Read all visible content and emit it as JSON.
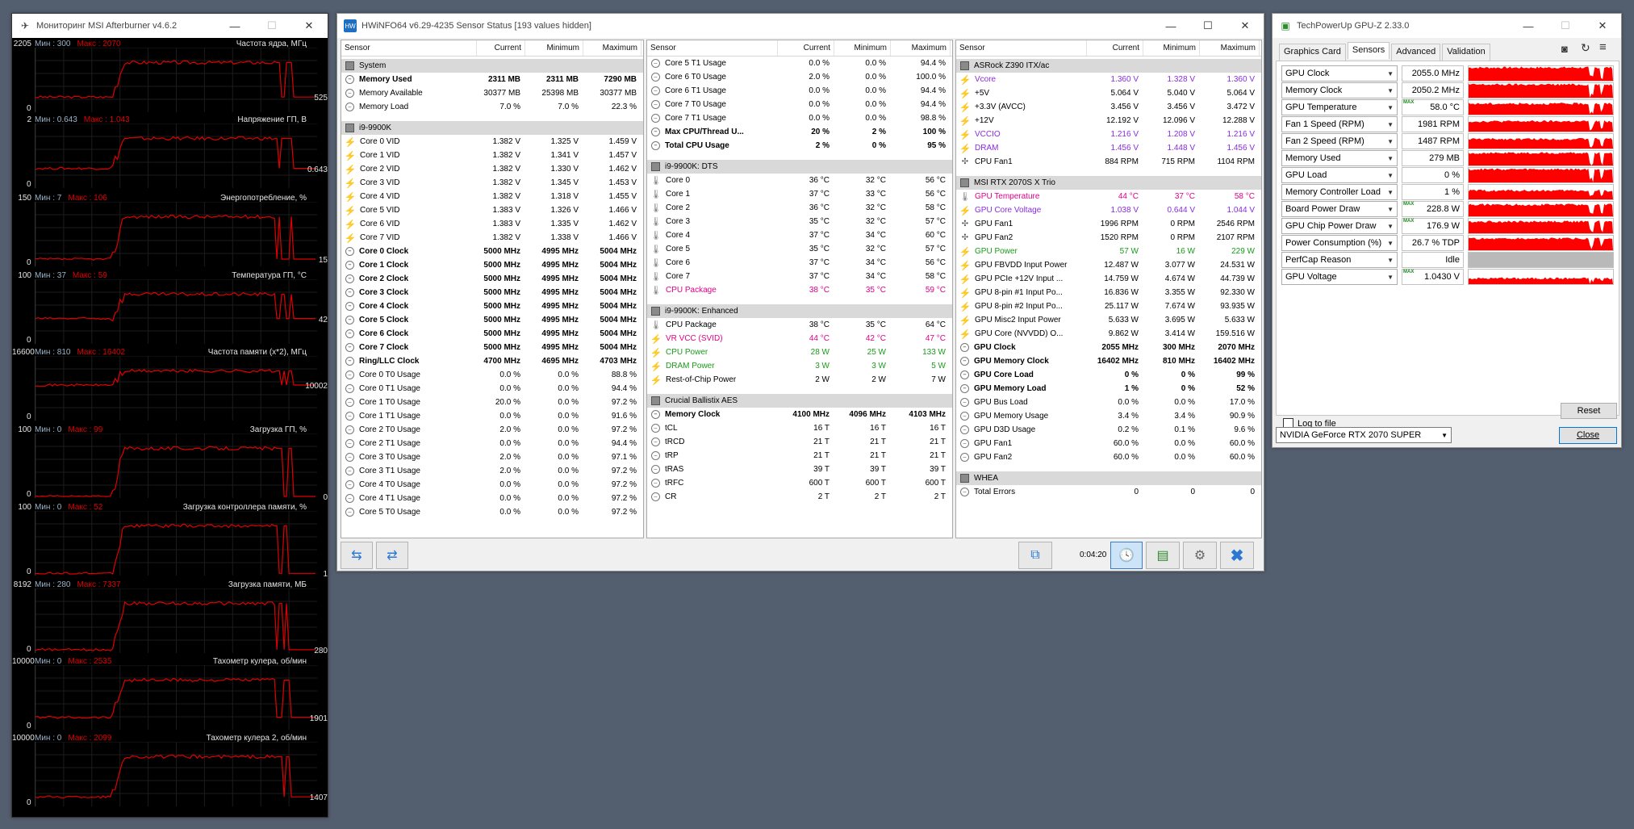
{
  "afterburner": {
    "title": "Мониторинг MSI Afterburner v4.6.2",
    "min_prefix": "Мин : ",
    "max_prefix": "Макс : ",
    "panels": [
      {
        "title": "Частота ядра, МГц",
        "min": "300",
        "max": "2070",
        "ymax": "2205",
        "ymin": "0",
        "current": "525",
        "level": 0.24
      },
      {
        "title": "Напряжение ГП, В",
        "min": "0.643",
        "max": "1.043",
        "ymax": "2",
        "ymin": "0",
        "current": "0.643",
        "level": 0.32
      },
      {
        "title": "Энергопотребление, %",
        "min": "7",
        "max": "106",
        "ymax": "150",
        "ymin": "0",
        "current": "15",
        "level": 0.1
      },
      {
        "title": "Температура ГП, °C",
        "min": "37",
        "max": "59",
        "ymax": "100",
        "ymin": "0",
        "current": "42",
        "level": 0.42
      },
      {
        "title": "Частота памяти (x*2), МГц",
        "min": "810",
        "max": "16402",
        "ymax": "16600",
        "ymin": "0",
        "current": "10002",
        "level": 0.6
      },
      {
        "title": "Загрузка ГП, %",
        "min": "0",
        "max": "99",
        "ymax": "100",
        "ymin": "0",
        "current": "0",
        "level": 0.0
      },
      {
        "title": "Загрузка контроллера памяти, %",
        "min": "0",
        "max": "52",
        "ymax": "100",
        "ymin": "0",
        "current": "1",
        "level": 0.01
      },
      {
        "title": "Загрузка памяти, МБ",
        "min": "280",
        "max": "7337",
        "ymax": "8192",
        "ymin": "0",
        "current": "280",
        "level": 0.03
      },
      {
        "title": "Тахометр кулера, об/мин",
        "min": "0",
        "max": "2535",
        "ymax": "10000",
        "ymin": "0",
        "current": "1901",
        "level": 0.19
      },
      {
        "title": "Тахометр кулера 2, об/мин",
        "min": "0",
        "max": "2099",
        "ymax": "10000",
        "ymin": "0",
        "current": "1407",
        "level": 0.14
      }
    ]
  },
  "hwinfo": {
    "title": "HWiNFO64 v6.29-4235 Sensor Status [193 values hidden]",
    "headers": [
      "Sensor",
      "Current",
      "Minimum",
      "Maximum"
    ],
    "columns": [
      [
        {
          "t": "grp",
          "name": "System"
        },
        {
          "i": "circ",
          "name": "Memory Used",
          "cur": "2311 MB",
          "min": "2311 MB",
          "max": "7290 MB",
          "b": 1
        },
        {
          "i": "circ",
          "name": "Memory Available",
          "cur": "30377 MB",
          "min": "25398 MB",
          "max": "30377 MB"
        },
        {
          "i": "circ",
          "name": "Memory Load",
          "cur": "7.0 %",
          "min": "7.0 %",
          "max": "22.3 %"
        },
        {
          "t": "sp"
        },
        {
          "t": "grp",
          "name": "i9-9900K"
        },
        {
          "i": "bolt",
          "name": "Core 0 VID",
          "cur": "1.382 V",
          "min": "1.325 V",
          "max": "1.459 V"
        },
        {
          "i": "bolt",
          "name": "Core 1 VID",
          "cur": "1.382 V",
          "min": "1.341 V",
          "max": "1.457 V"
        },
        {
          "i": "bolt",
          "name": "Core 2 VID",
          "cur": "1.382 V",
          "min": "1.330 V",
          "max": "1.462 V"
        },
        {
          "i": "bolt",
          "name": "Core 3 VID",
          "cur": "1.382 V",
          "min": "1.345 V",
          "max": "1.453 V"
        },
        {
          "i": "bolt",
          "name": "Core 4 VID",
          "cur": "1.382 V",
          "min": "1.318 V",
          "max": "1.455 V"
        },
        {
          "i": "bolt",
          "name": "Core 5 VID",
          "cur": "1.383 V",
          "min": "1.326 V",
          "max": "1.466 V"
        },
        {
          "i": "bolt",
          "name": "Core 6 VID",
          "cur": "1.383 V",
          "min": "1.335 V",
          "max": "1.462 V"
        },
        {
          "i": "bolt",
          "name": "Core 7 VID",
          "cur": "1.382 V",
          "min": "1.338 V",
          "max": "1.466 V"
        },
        {
          "i": "circ",
          "name": "Core 0 Clock",
          "cur": "5000 MHz",
          "min": "4995 MHz",
          "max": "5004 MHz",
          "b": 1
        },
        {
          "i": "circ",
          "name": "Core 1 Clock",
          "cur": "5000 MHz",
          "min": "4995 MHz",
          "max": "5004 MHz",
          "b": 1
        },
        {
          "i": "circ",
          "name": "Core 2 Clock",
          "cur": "5000 MHz",
          "min": "4995 MHz",
          "max": "5004 MHz",
          "b": 1
        },
        {
          "i": "circ",
          "name": "Core 3 Clock",
          "cur": "5000 MHz",
          "min": "4995 MHz",
          "max": "5004 MHz",
          "b": 1
        },
        {
          "i": "circ",
          "name": "Core 4 Clock",
          "cur": "5000 MHz",
          "min": "4995 MHz",
          "max": "5004 MHz",
          "b": 1
        },
        {
          "i": "circ",
          "name": "Core 5 Clock",
          "cur": "5000 MHz",
          "min": "4995 MHz",
          "max": "5004 MHz",
          "b": 1
        },
        {
          "i": "circ",
          "name": "Core 6 Clock",
          "cur": "5000 MHz",
          "min": "4995 MHz",
          "max": "5004 MHz",
          "b": 1
        },
        {
          "i": "circ",
          "name": "Core 7 Clock",
          "cur": "5000 MHz",
          "min": "4995 MHz",
          "max": "5004 MHz",
          "b": 1
        },
        {
          "i": "circ",
          "name": "Ring/LLC Clock",
          "cur": "4700 MHz",
          "min": "4695 MHz",
          "max": "4703 MHz",
          "b": 1
        },
        {
          "i": "circ",
          "name": "Core 0 T0 Usage",
          "cur": "0.0 %",
          "min": "0.0 %",
          "max": "88.8 %"
        },
        {
          "i": "circ",
          "name": "Core 0 T1 Usage",
          "cur": "0.0 %",
          "min": "0.0 %",
          "max": "94.4 %"
        },
        {
          "i": "circ",
          "name": "Core 1 T0 Usage",
          "cur": "20.0 %",
          "min": "0.0 %",
          "max": "97.2 %"
        },
        {
          "i": "circ",
          "name": "Core 1 T1 Usage",
          "cur": "0.0 %",
          "min": "0.0 %",
          "max": "91.6 %"
        },
        {
          "i": "circ",
          "name": "Core 2 T0 Usage",
          "cur": "2.0 %",
          "min": "0.0 %",
          "max": "97.2 %"
        },
        {
          "i": "circ",
          "name": "Core 2 T1 Usage",
          "cur": "0.0 %",
          "min": "0.0 %",
          "max": "94.4 %"
        },
        {
          "i": "circ",
          "name": "Core 3 T0 Usage",
          "cur": "2.0 %",
          "min": "0.0 %",
          "max": "97.1 %"
        },
        {
          "i": "circ",
          "name": "Core 3 T1 Usage",
          "cur": "2.0 %",
          "min": "0.0 %",
          "max": "97.2 %"
        },
        {
          "i": "circ",
          "name": "Core 4 T0 Usage",
          "cur": "0.0 %",
          "min": "0.0 %",
          "max": "97.2 %"
        },
        {
          "i": "circ",
          "name": "Core 4 T1 Usage",
          "cur": "0.0 %",
          "min": "0.0 %",
          "max": "97.2 %"
        },
        {
          "i": "circ",
          "name": "Core 5 T0 Usage",
          "cur": "0.0 %",
          "min": "0.0 %",
          "max": "97.2 %"
        }
      ],
      [
        {
          "i": "circ",
          "name": "Core 5 T1 Usage",
          "cur": "0.0 %",
          "min": "0.0 %",
          "max": "94.4 %"
        },
        {
          "i": "circ",
          "name": "Core 6 T0 Usage",
          "cur": "2.0 %",
          "min": "0.0 %",
          "max": "100.0 %"
        },
        {
          "i": "circ",
          "name": "Core 6 T1 Usage",
          "cur": "0.0 %",
          "min": "0.0 %",
          "max": "94.4 %"
        },
        {
          "i": "circ",
          "name": "Core 7 T0 Usage",
          "cur": "0.0 %",
          "min": "0.0 %",
          "max": "94.4 %"
        },
        {
          "i": "circ",
          "name": "Core 7 T1 Usage",
          "cur": "0.0 %",
          "min": "0.0 %",
          "max": "98.8 %"
        },
        {
          "i": "circ",
          "name": "Max CPU/Thread U...",
          "cur": "20 %",
          "min": "2 %",
          "max": "100 %",
          "b": 1
        },
        {
          "i": "circ",
          "name": "Total CPU Usage",
          "cur": "2 %",
          "min": "0 %",
          "max": "95 %",
          "b": 1
        },
        {
          "t": "sp"
        },
        {
          "t": "grp",
          "name": "i9-9900K: DTS"
        },
        {
          "i": "therm",
          "name": "Core 0",
          "cur": "36 °C",
          "min": "32 °C",
          "max": "56 °C"
        },
        {
          "i": "therm",
          "name": "Core 1",
          "cur": "37 °C",
          "min": "33 °C",
          "max": "56 °C"
        },
        {
          "i": "therm",
          "name": "Core 2",
          "cur": "36 °C",
          "min": "32 °C",
          "max": "58 °C"
        },
        {
          "i": "therm",
          "name": "Core 3",
          "cur": "35 °C",
          "min": "32 °C",
          "max": "57 °C"
        },
        {
          "i": "therm",
          "name": "Core 4",
          "cur": "37 °C",
          "min": "34 °C",
          "max": "60 °C"
        },
        {
          "i": "therm",
          "name": "Core 5",
          "cur": "35 °C",
          "min": "32 °C",
          "max": "57 °C"
        },
        {
          "i": "therm",
          "name": "Core 6",
          "cur": "37 °C",
          "min": "34 °C",
          "max": "56 °C"
        },
        {
          "i": "therm",
          "name": "Core 7",
          "cur": "37 °C",
          "min": "34 °C",
          "max": "58 °C"
        },
        {
          "i": "therm",
          "name": "CPU Package",
          "cur": "38 °C",
          "min": "35 °C",
          "max": "59 °C",
          "c": "red"
        },
        {
          "t": "sp"
        },
        {
          "t": "grp",
          "name": "i9-9900K: Enhanced"
        },
        {
          "i": "therm",
          "name": "CPU Package",
          "cur": "38 °C",
          "min": "35 °C",
          "max": "64 °C"
        },
        {
          "i": "bolt",
          "name": "VR VCC (SVID)",
          "cur": "44 °C",
          "min": "42 °C",
          "max": "47 °C",
          "c": "red"
        },
        {
          "i": "bolt",
          "name": "CPU Power",
          "cur": "28 W",
          "min": "25 W",
          "max": "133 W",
          "c": "grn"
        },
        {
          "i": "bolt",
          "name": "DRAM Power",
          "cur": "3 W",
          "min": "3 W",
          "max": "5 W",
          "c": "grn"
        },
        {
          "i": "bolt",
          "name": "Rest-of-Chip Power",
          "cur": "2 W",
          "min": "2 W",
          "max": "7 W"
        },
        {
          "t": "sp"
        },
        {
          "t": "grp",
          "name": "Crucial Ballistix AES"
        },
        {
          "i": "circ",
          "name": "Memory Clock",
          "cur": "4100 MHz",
          "min": "4096 MHz",
          "max": "4103 MHz",
          "b": 1
        },
        {
          "i": "circ",
          "name": "tCL",
          "cur": "16 T",
          "min": "16 T",
          "max": "16 T"
        },
        {
          "i": "circ",
          "name": "tRCD",
          "cur": "21 T",
          "min": "21 T",
          "max": "21 T"
        },
        {
          "i": "circ",
          "name": "tRP",
          "cur": "21 T",
          "min": "21 T",
          "max": "21 T"
        },
        {
          "i": "circ",
          "name": "tRAS",
          "cur": "39 T",
          "min": "39 T",
          "max": "39 T"
        },
        {
          "i": "circ",
          "name": "tRFC",
          "cur": "600 T",
          "min": "600 T",
          "max": "600 T"
        },
        {
          "i": "circ",
          "name": "CR",
          "cur": "2 T",
          "min": "2 T",
          "max": "2 T"
        }
      ],
      [
        {
          "t": "grp",
          "name": "ASRock Z390 ITX/ac"
        },
        {
          "i": "bolt",
          "name": "Vcore",
          "cur": "1.360 V",
          "min": "1.328 V",
          "max": "1.360 V",
          "c": "pur"
        },
        {
          "i": "bolt",
          "name": "+5V",
          "cur": "5.064 V",
          "min": "5.040 V",
          "max": "5.064 V"
        },
        {
          "i": "bolt",
          "name": "+3.3V (AVCC)",
          "cur": "3.456 V",
          "min": "3.456 V",
          "max": "3.472 V"
        },
        {
          "i": "bolt",
          "name": "+12V",
          "cur": "12.192 V",
          "min": "12.096 V",
          "max": "12.288 V"
        },
        {
          "i": "bolt",
          "name": "VCCIO",
          "cur": "1.216 V",
          "min": "1.208 V",
          "max": "1.216 V",
          "c": "pur"
        },
        {
          "i": "bolt",
          "name": "DRAM",
          "cur": "1.456 V",
          "min": "1.448 V",
          "max": "1.456 V",
          "c": "pur"
        },
        {
          "i": "fan",
          "name": "CPU Fan1",
          "cur": "884 RPM",
          "min": "715 RPM",
          "max": "1104 RPM"
        },
        {
          "t": "sp"
        },
        {
          "t": "grp",
          "name": "MSI RTX 2070S X Trio"
        },
        {
          "i": "therm",
          "name": "GPU Temperature",
          "cur": "44 °C",
          "min": "37 °C",
          "max": "58 °C",
          "c": "red"
        },
        {
          "i": "bolt",
          "name": "GPU Core Voltage",
          "cur": "1.038 V",
          "min": "0.644 V",
          "max": "1.044 V",
          "c": "pur"
        },
        {
          "i": "fan",
          "name": "GPU Fan1",
          "cur": "1996 RPM",
          "min": "0 RPM",
          "max": "2546 RPM"
        },
        {
          "i": "fan",
          "name": "GPU Fan2",
          "cur": "1520 RPM",
          "min": "0 RPM",
          "max": "2107 RPM"
        },
        {
          "i": "bolt",
          "name": "GPU Power",
          "cur": "57 W",
          "min": "16 W",
          "max": "229 W",
          "c": "grn"
        },
        {
          "i": "bolt",
          "name": "GPU FBVDD Input Power",
          "cur": "12.487 W",
          "min": "3.077 W",
          "max": "24.531 W"
        },
        {
          "i": "bolt",
          "name": "GPU PCIe +12V Input ...",
          "cur": "14.759 W",
          "min": "4.674 W",
          "max": "44.739 W"
        },
        {
          "i": "bolt",
          "name": "GPU 8-pin #1 Input Po...",
          "cur": "16.836 W",
          "min": "3.355 W",
          "max": "92.330 W"
        },
        {
          "i": "bolt",
          "name": "GPU 8-pin #2 Input Po...",
          "cur": "25.117 W",
          "min": "7.674 W",
          "max": "93.935 W"
        },
        {
          "i": "bolt",
          "name": "GPU Misc2 Input Power",
          "cur": "5.633 W",
          "min": "3.695 W",
          "max": "5.633 W"
        },
        {
          "i": "bolt",
          "name": "GPU Core (NVVDD) O...",
          "cur": "9.862 W",
          "min": "3.414 W",
          "max": "159.516 W"
        },
        {
          "i": "circ",
          "name": "GPU Clock",
          "cur": "2055 MHz",
          "min": "300 MHz",
          "max": "2070 MHz",
          "b": 1
        },
        {
          "i": "circ",
          "name": "GPU Memory Clock",
          "cur": "16402 MHz",
          "min": "810 MHz",
          "max": "16402 MHz",
          "b": 1
        },
        {
          "i": "circ",
          "name": "GPU Core Load",
          "cur": "0 %",
          "min": "0 %",
          "max": "99 %",
          "b": 1
        },
        {
          "i": "circ",
          "name": "GPU Memory Load",
          "cur": "1 %",
          "min": "0 %",
          "max": "52 %",
          "b": 1
        },
        {
          "i": "circ",
          "name": "GPU Bus Load",
          "cur": "0.0 %",
          "min": "0.0 %",
          "max": "17.0 %"
        },
        {
          "i": "circ",
          "name": "GPU Memory Usage",
          "cur": "3.4 %",
          "min": "3.4 %",
          "max": "90.9 %"
        },
        {
          "i": "circ",
          "name": "GPU D3D Usage",
          "cur": "0.2 %",
          "min": "0.1 %",
          "max": "9.6 %"
        },
        {
          "i": "circ",
          "name": "GPU Fan1",
          "cur": "60.0 %",
          "min": "0.0 %",
          "max": "60.0 %"
        },
        {
          "i": "circ",
          "name": "GPU Fan2",
          "cur": "60.0 %",
          "min": "0.0 %",
          "max": "60.0 %"
        },
        {
          "t": "sp"
        },
        {
          "t": "grp",
          "name": "WHEA"
        },
        {
          "i": "circ",
          "name": "Total Errors",
          "cur": "0",
          "min": "0",
          "max": "0"
        }
      ]
    ],
    "footer": {
      "time": "0:04:20"
    }
  },
  "gpuz": {
    "title": "TechPowerUp GPU-Z 2.33.0",
    "tabs": [
      "Graphics Card",
      "Sensors",
      "Advanced",
      "Validation"
    ],
    "active_tab": "Sensors",
    "max_tag": "MAX",
    "sensors": [
      {
        "name": "GPU Clock",
        "value": "2055.0 MHz",
        "max": false,
        "fill": 0.9
      },
      {
        "name": "Memory Clock",
        "value": "2050.2 MHz",
        "max": false,
        "fill": 0.9
      },
      {
        "name": "GPU Temperature",
        "value": "58.0 °C",
        "max": true,
        "fill": 0.75
      },
      {
        "name": "Fan 1 Speed (RPM)",
        "value": "1981 RPM",
        "max": false,
        "fill": 0.7
      },
      {
        "name": "Fan 2 Speed (RPM)",
        "value": "1487 RPM",
        "max": false,
        "fill": 0.65
      },
      {
        "name": "Memory Used",
        "value": "279 MB",
        "max": false,
        "fill": 0.85
      },
      {
        "name": "GPU Load",
        "value": "0 %",
        "max": false,
        "fill": 0.9
      },
      {
        "name": "Memory Controller Load",
        "value": "1 %",
        "max": false,
        "fill": 0.6
      },
      {
        "name": "Board Power Draw",
        "value": "228.8 W",
        "max": true,
        "fill": 0.8
      },
      {
        "name": "GPU Chip Power Draw",
        "value": "176.9 W",
        "max": true,
        "fill": 0.8
      },
      {
        "name": "Power Consumption (%)",
        "value": "26.7 % TDP",
        "max": false,
        "fill": 0.8
      },
      {
        "name": "PerfCap Reason",
        "value": "Idle",
        "max": false,
        "fill": -1
      },
      {
        "name": "GPU Voltage",
        "value": "1.0430 V",
        "max": true,
        "fill": 0.4
      }
    ],
    "log_label": "Log to file",
    "reset_label": "Reset",
    "gpu_select": "NVIDIA GeForce RTX 2070 SUPER",
    "close_label": "Close"
  }
}
